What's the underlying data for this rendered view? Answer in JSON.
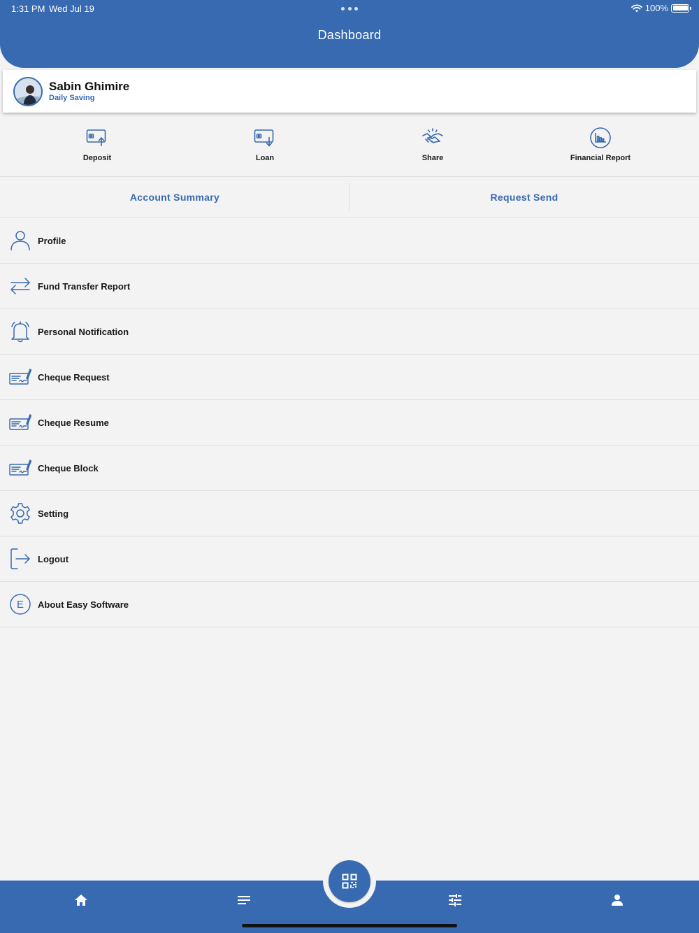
{
  "status_bar": {
    "time": "1:31 PM",
    "date": "Wed Jul 19",
    "battery": "100%"
  },
  "header": {
    "title": "Dashboard"
  },
  "profile": {
    "name": "Sabin Ghimire",
    "account_type": "Daily Saving"
  },
  "quick_actions": [
    {
      "label": "Deposit",
      "icon": "deposit-icon"
    },
    {
      "label": "Loan",
      "icon": "loan-icon"
    },
    {
      "label": "Share",
      "icon": "handshake-icon"
    },
    {
      "label": "Financial Report",
      "icon": "chart-icon"
    }
  ],
  "tabs": [
    {
      "label": "Account Summary"
    },
    {
      "label": "Request Send"
    }
  ],
  "menu": [
    {
      "label": "Profile",
      "icon": "user-icon"
    },
    {
      "label": "Fund Transfer Report",
      "icon": "transfer-arrows-icon"
    },
    {
      "label": "Personal Notification",
      "icon": "bell-icon"
    },
    {
      "label": "Cheque Request",
      "icon": "cheque-icon"
    },
    {
      "label": "Cheque Resume",
      "icon": "cheque-icon"
    },
    {
      "label": "Cheque Block",
      "icon": "cheque-icon"
    },
    {
      "label": "Setting",
      "icon": "gear-icon"
    },
    {
      "label": "Logout",
      "icon": "logout-icon"
    },
    {
      "label": "About Easy Software",
      "icon": "easy-software-icon",
      "icon_letter": "E"
    }
  ],
  "bottom_nav": [
    {
      "icon": "home-icon"
    },
    {
      "icon": "menu-lines-icon"
    },
    {
      "icon": "qr-code-icon"
    },
    {
      "icon": "sliders-icon"
    },
    {
      "icon": "account-icon"
    }
  ],
  "colors": {
    "primary": "#376ab0",
    "background": "#f3f3f3"
  }
}
